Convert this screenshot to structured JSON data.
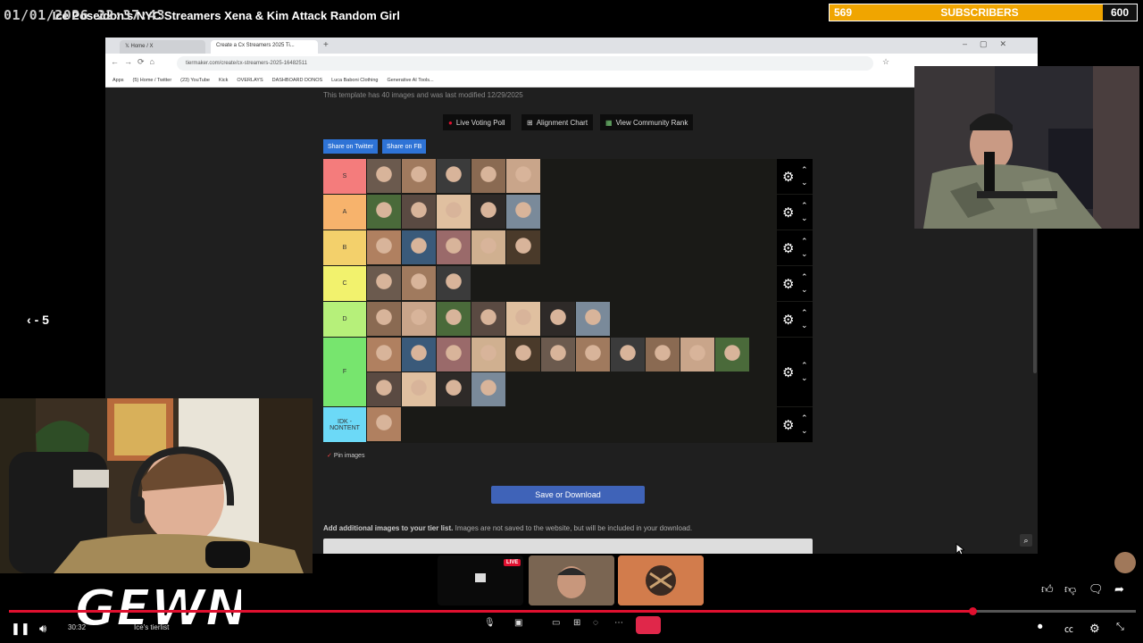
{
  "overlay": {
    "timestamp": "01/01/2026 22:37:43",
    "video_title": "Ice Poseidon's NYC Streamers Xena & Kim Attack Random Girl",
    "subscribers": {
      "current": "569",
      "label": "SUBSCRIBERS",
      "goal": "600",
      "progress": 0.9483
    },
    "rewind_label": "- 5"
  },
  "browser": {
    "tabs": [
      {
        "label": "Home / X"
      },
      {
        "label": "Create a Cx Streamers 2025 Ti..."
      }
    ],
    "url": "tiermaker.com/create/cx-streamers-2025-16482511",
    "bookmarks": [
      "Apps",
      "(5) Home / Twitter",
      "(23) YouTube",
      "Kick",
      "OVERLAYS",
      "DASHBOARD DONOS",
      "Luca Baboni Clothing",
      "Generative AI Tools..."
    ],
    "template_note": "This template has 40 images and was last modified 12/29/2025",
    "buttons": {
      "live_poll": "Live Voting Poll",
      "alignment": "Alignment Chart",
      "community": "View Community Rank",
      "share_twitter": "Share on Twitter",
      "share_fb": "Share on FB",
      "save": "Save or Download"
    },
    "tiers": [
      {
        "label": "S",
        "color": "#f47c7c",
        "images": 5
      },
      {
        "label": "A",
        "color": "#f7b36c",
        "images": 5
      },
      {
        "label": "B",
        "color": "#f3d06b",
        "images": 5
      },
      {
        "label": "C",
        "color": "#f2f26d",
        "images": 3
      },
      {
        "label": "D",
        "color": "#b6f07a",
        "images": 7
      },
      {
        "label": "F",
        "color": "#77e56e",
        "images": 15
      },
      {
        "label": "IDK - NONTENT",
        "color": "#6cd9f7",
        "images": 1
      }
    ],
    "pin_images": "Pin images",
    "additional_images_bold": "Add additional images to your tier list.",
    "additional_images_rest": "Images are not saved to the website, but will be included in your download."
  },
  "player": {
    "time": "30:32",
    "chapter": "Ice's tierlist",
    "progress": 0.855
  },
  "logo_text": "GEWN",
  "colors": {
    "accent_red": "#e0102f",
    "sub_bar": "#f0a500",
    "save_button": "#3f63b8",
    "share_blue": "#2e73d6"
  }
}
